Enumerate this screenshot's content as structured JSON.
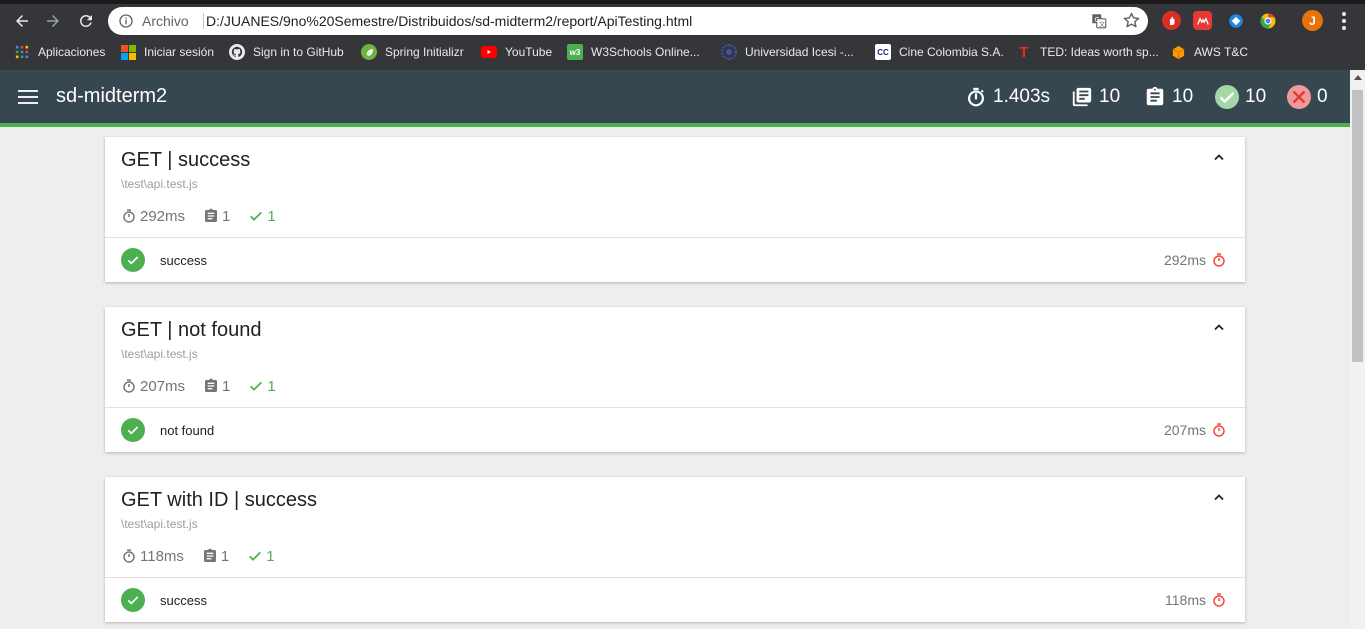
{
  "browser": {
    "omnibox": {
      "label": "Archivo",
      "url": "D:/JUANES/9no%20Semestre/Distribuidos/sd-midterm2/report/ApiTesting.html"
    },
    "avatar_letter": "J",
    "bookmarks": [
      {
        "label": "Aplicaciones",
        "icon": "apps-grid-icon"
      },
      {
        "label": "Iniciar sesión",
        "icon": "microsoft-icon"
      },
      {
        "label": "Sign in to GitHub",
        "icon": "github-icon"
      },
      {
        "label": "Spring Initializr",
        "icon": "spring-icon"
      },
      {
        "label": "YouTube",
        "icon": "youtube-icon"
      },
      {
        "label": "W3Schools Online...",
        "icon": "w3schools-icon"
      },
      {
        "label": "Universidad Icesi -...",
        "icon": "icesi-icon"
      },
      {
        "label": "Cine Colombia S.A.",
        "icon": "cine-colombia-icon"
      },
      {
        "label": "TED: Ideas worth sp...",
        "icon": "ted-icon"
      },
      {
        "label": "AWS T&C",
        "icon": "aws-icon"
      }
    ]
  },
  "header": {
    "title": "sd-midterm2",
    "stats": {
      "duration": "1.403s",
      "suites": "10",
      "tests": "10",
      "passed": "10",
      "failed": "0"
    }
  },
  "colors": {
    "header_bg": "#37474f",
    "accent": "#4caf50",
    "fail": "#f44336"
  },
  "suites": [
    {
      "title": "GET | success",
      "file": "\\test\\api.test.js",
      "duration": "292ms",
      "tests": "1",
      "passes": "1",
      "test_name": "success",
      "test_duration": "292ms"
    },
    {
      "title": "GET | not found",
      "file": "\\test\\api.test.js",
      "duration": "207ms",
      "tests": "1",
      "passes": "1",
      "test_name": "not found",
      "test_duration": "207ms"
    },
    {
      "title": "GET with ID | success",
      "file": "\\test\\api.test.js",
      "duration": "118ms",
      "tests": "1",
      "passes": "1",
      "test_name": "success",
      "test_duration": "118ms"
    }
  ]
}
